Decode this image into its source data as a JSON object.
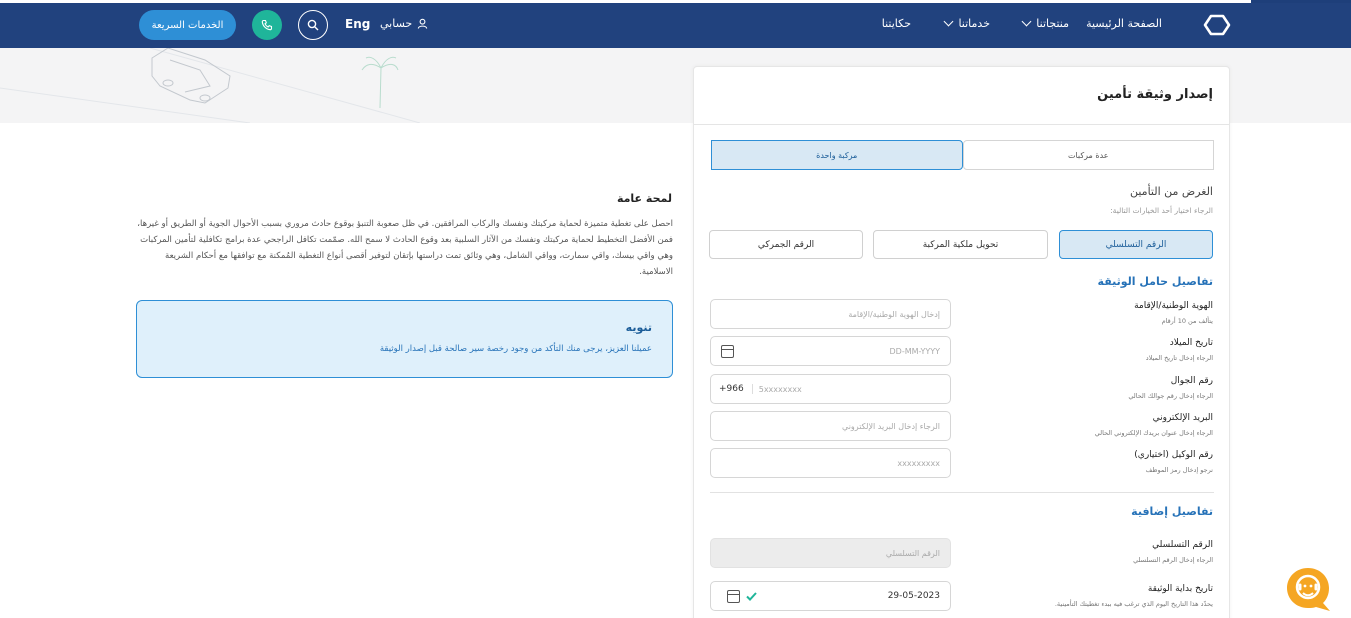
{
  "header": {
    "nav": {
      "home": "الصفحة الرئيسية",
      "products": "منتجاتنا",
      "services": "خدماتنا",
      "story": "حكايتنا"
    },
    "account": "حسابي",
    "lang": "Eng",
    "quick_services": "الخدمات السريعة"
  },
  "form": {
    "title": "إصدار وثيقة تأمين",
    "vehicle_tabs": [
      "مركبة واحدة",
      "عدة مركبات"
    ],
    "purpose": {
      "title": "الغرض من التأمين",
      "hint": "الرجاء اختيار أحد الخيارات التالية:",
      "options": [
        "الرقم التسلسلي",
        "تحويل ملكية المركبة",
        "الرقم الجمركي"
      ],
      "selected": "الرقم التسلسلي"
    },
    "holder": {
      "title": "تفاصيل حامل الوثيقة",
      "fields": [
        {
          "label": "الهوية الوطنية/الإقامة",
          "hint": "يتألف من 10 أرقام",
          "placeholder": "إدخال الهوية الوطنية/الإقامة"
        },
        {
          "label": "تاريخ الميلاد",
          "hint": "الرجاء إدخال تاريخ الميلاد",
          "placeholder": "DD-MM-YYYY"
        },
        {
          "label": "رقم الجوال",
          "hint": "الرجاء إدخال رقم جوالك الحالي",
          "prefix": "+966",
          "placeholder": "5xxxxxxxx"
        },
        {
          "label": "البريد الإلكتروني",
          "hint": "الرجاء إدخال عنوان بريدك الإلكتروني الحالي",
          "placeholder": "الرجاء إدخال البريد الإلكتروني"
        },
        {
          "label": "رقم الوكيل (اختياري)",
          "hint": "نرجو إدخال رمز الموظف",
          "placeholder": "xxxxxxxxx"
        }
      ]
    },
    "additional": {
      "title": "تفاصيل إضافية",
      "serial": {
        "label": "الرقم التسلسلي",
        "hint": "الرجاء إدخال الرقم التسلسلي",
        "placeholder": "الرقم التسلسلي"
      },
      "start_date": {
        "label": "تاريخ بداية الوثيقة",
        "hint": "يحدّد هذا التاريخ اليوم الذي ترغب فيه ببدء تغطيتك التأمينية.",
        "value": "29-05-2023"
      }
    }
  },
  "overview": {
    "title": "لمحة عامة",
    "text": "احصل على تغطية متميزة لحماية مركبتك ونفسك والركاب المرافقين. في ظل صعوبة التنبؤ بوقوع حادث مروري بسبب الأحوال الجوية أو الطريق أو غيرها، فمن الأفضل التخطيط لحماية مركبتك ونفسك من الآثار السلبية بعد وقوع الحادث لا سمح الله. صمّمت تكافل الراجحي عدة برامج تكافلية لتأمين المركبات وهي واقي بيسك، واقي سمارت، وواقي الشامل، وهي وثائق تمت دراستها بإتقان لتوفير أقصى أنواع التغطية المُمكنة مع توافقها مع أحكام الشريعة الاسلامية."
  },
  "notice": {
    "title": "تنويه",
    "body": "عميلنا العزيز، يرجى منك التأكد من وجود رخصة سير صالحة قبل إصدار الوثيقة"
  },
  "colors": {
    "nav_bg": "#21427e",
    "accent_blue": "#2e8fd6",
    "teal": "#1fb59a",
    "chatbot": "#f5a623"
  }
}
